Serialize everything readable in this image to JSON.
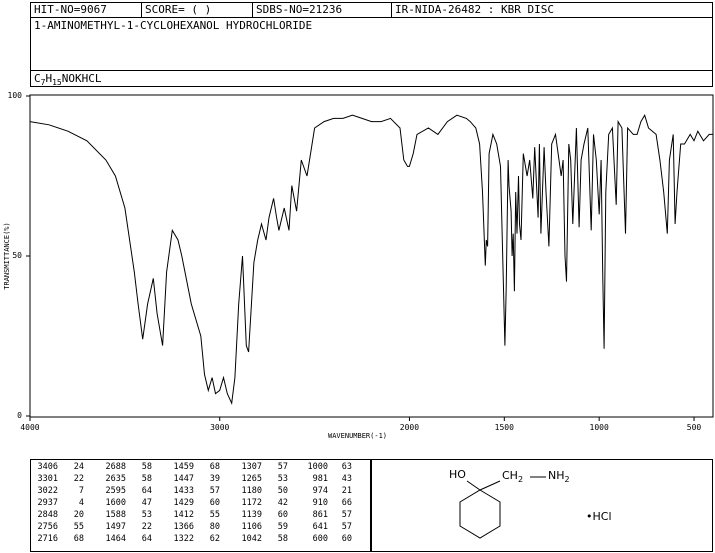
{
  "header": {
    "hit_no": "HIT-NO=9067",
    "score": "SCORE=  (   )",
    "sdbs_no": "SDBS-NO=21236",
    "ir_code": "IR-NIDA-26482 : KBR DISC"
  },
  "compound": {
    "name": "1-AMINOMETHYL-1-CYCLOHEXANOL HYDROCHLORIDE",
    "formula_parts": [
      "C",
      "7",
      "H",
      "15",
      "NOKHCL"
    ]
  },
  "structure": {
    "ho_label": "HO",
    "ch2_label": "CH",
    "ch2_sub": "2",
    "nh2_label": "NH",
    "nh2_sub": "2",
    "hcl_label": "•HCl"
  },
  "chart_data": {
    "type": "line",
    "title": "",
    "xlabel": "WAVENUMBER(-1)",
    "ylabel": "TRANSMITTANCE(%)",
    "xlim": [
      4000,
      400
    ],
    "ylim": [
      0,
      100
    ],
    "x_ticks": [
      4000,
      3000,
      2000,
      1500,
      1000,
      500
    ],
    "y_ticks": [
      0,
      50,
      100
    ],
    "grid": false,
    "series": [
      {
        "x": [
          4000,
          3900,
          3800,
          3700,
          3600,
          3550,
          3500,
          3450,
          3430,
          3406,
          3380,
          3350,
          3330,
          3301,
          3280,
          3250,
          3220,
          3200,
          3150,
          3100,
          3080,
          3060,
          3040,
          3022,
          3000,
          2980,
          2960,
          2937,
          2920,
          2900,
          2880,
          2860,
          2848,
          2820,
          2800,
          2780,
          2756,
          2740,
          2716,
          2700,
          2688,
          2660,
          2635,
          2620,
          2595,
          2570,
          2540,
          2500,
          2450,
          2400,
          2350,
          2300,
          2250,
          2200,
          2150,
          2100,
          2050,
          2030,
          2010,
          2000,
          1980,
          1960,
          1900,
          1850,
          1800,
          1750,
          1700,
          1680,
          1650,
          1630,
          1615,
          1600,
          1595,
          1588,
          1580,
          1560,
          1540,
          1520,
          1497,
          1490,
          1480,
          1475,
          1464,
          1459,
          1453,
          1447,
          1440,
          1433,
          1425,
          1420,
          1412,
          1400,
          1380,
          1366,
          1350,
          1340,
          1322,
          1315,
          1307,
          1290,
          1280,
          1265,
          1250,
          1230,
          1200,
          1190,
          1180,
          1172,
          1160,
          1150,
          1139,
          1120,
          1106,
          1095,
          1080,
          1060,
          1042,
          1030,
          1015,
          1000,
          990,
          981,
          974,
          965,
          950,
          930,
          910,
          900,
          880,
          861,
          850,
          820,
          800,
          780,
          760,
          740,
          700,
          680,
          660,
          641,
          630,
          610,
          600,
          590,
          570,
          550,
          520,
          500,
          480,
          450,
          420,
          400
        ],
        "values": [
          92,
          91,
          89,
          86,
          80,
          75,
          65,
          45,
          35,
          24,
          35,
          43,
          32,
          22,
          45,
          58,
          55,
          50,
          35,
          25,
          13,
          8,
          12,
          7,
          8,
          12,
          7,
          4,
          12,
          35,
          50,
          22,
          20,
          48,
          55,
          60,
          55,
          62,
          68,
          62,
          58,
          65,
          58,
          72,
          64,
          80,
          75,
          90,
          92,
          93,
          93,
          94,
          93,
          92,
          92,
          93,
          90,
          80,
          78,
          78,
          82,
          88,
          90,
          88,
          92,
          94,
          93,
          92,
          90,
          85,
          70,
          47,
          55,
          53,
          82,
          88,
          85,
          78,
          22,
          40,
          80,
          72,
          64,
          50,
          57,
          39,
          70,
          57,
          75,
          60,
          55,
          82,
          75,
          80,
          68,
          84,
          62,
          85,
          57,
          84,
          70,
          53,
          85,
          88,
          75,
          80,
          50,
          42,
          85,
          80,
          60,
          90,
          59,
          80,
          85,
          90,
          58,
          88,
          80,
          63,
          80,
          43,
          21,
          70,
          88,
          90,
          66,
          92,
          90,
          57,
          90,
          88,
          88,
          92,
          94,
          90,
          88,
          80,
          70,
          57,
          80,
          88,
          60,
          70,
          85,
          85,
          88,
          86,
          89,
          86,
          88,
          88
        ]
      }
    ]
  },
  "peak_table": [
    [
      "3406",
      "24",
      "2688",
      "58",
      "1459",
      "68",
      "1307",
      "57",
      "1000",
      "63"
    ],
    [
      "3301",
      "22",
      "2635",
      "58",
      "1447",
      "39",
      "1265",
      "53",
      "981",
      "43"
    ],
    [
      "3022",
      "7",
      "2595",
      "64",
      "1433",
      "57",
      "1180",
      "50",
      "974",
      "21"
    ],
    [
      "2937",
      "4",
      "1600",
      "47",
      "1429",
      "60",
      "1172",
      "42",
      "910",
      "66"
    ],
    [
      "2848",
      "20",
      "1588",
      "53",
      "1412",
      "55",
      "1139",
      "60",
      "861",
      "57"
    ],
    [
      "2756",
      "55",
      "1497",
      "22",
      "1366",
      "80",
      "1106",
      "59",
      "641",
      "57"
    ],
    [
      "2716",
      "68",
      "1464",
      "64",
      "1322",
      "62",
      "1042",
      "58",
      "600",
      "60"
    ]
  ]
}
